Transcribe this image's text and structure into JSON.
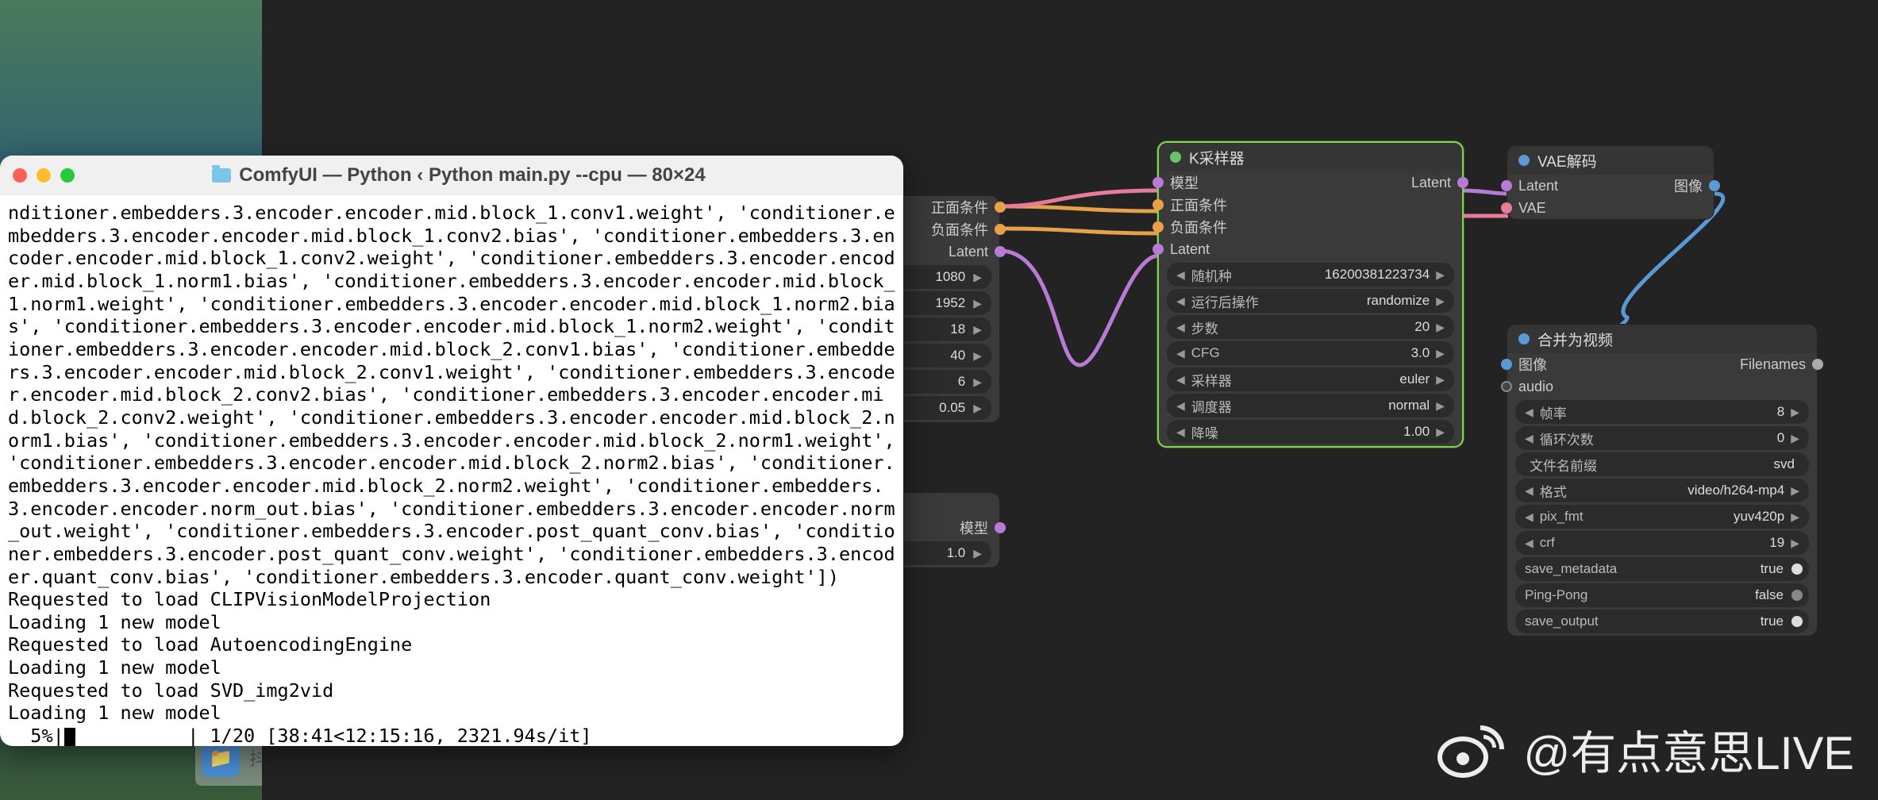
{
  "desktop": {
    "dock_label": "抖"
  },
  "terminal": {
    "title": "ComfyUI — Python ‹ Python main.py --cpu — 80×24",
    "body": "nditioner.embedders.3.encoder.encoder.mid.block_1.conv1.weight', 'conditioner.embedders.3.encoder.encoder.mid.block_1.conv2.bias', 'conditioner.embedders.3.encoder.encoder.mid.block_1.conv2.weight', 'conditioner.embedders.3.encoder.encoder.mid.block_1.norm1.bias', 'conditioner.embedders.3.encoder.encoder.mid.block_1.norm1.weight', 'conditioner.embedders.3.encoder.encoder.mid.block_1.norm2.bias', 'conditioner.embedders.3.encoder.encoder.mid.block_1.norm2.weight', 'conditioner.embedders.3.encoder.encoder.mid.block_2.conv1.bias', 'conditioner.embedders.3.encoder.encoder.mid.block_2.conv1.weight', 'conditioner.embedders.3.encoder.encoder.mid.block_2.conv2.bias', 'conditioner.embedders.3.encoder.encoder.mid.block_2.conv2.weight', 'conditioner.embedders.3.encoder.encoder.mid.block_2.norm1.bias', 'conditioner.embedders.3.encoder.encoder.mid.block_2.norm1.weight', 'conditioner.embedders.3.encoder.encoder.mid.block_2.norm2.bias', 'conditioner.embedders.3.encoder.encoder.mid.block_2.norm2.weight', 'conditioner.embedders.3.encoder.encoder.norm_out.bias', 'conditioner.embedders.3.encoder.encoder.norm_out.weight', 'conditioner.embedders.3.encoder.post_quant_conv.bias', 'conditioner.embedders.3.encoder.post_quant_conv.weight', 'conditioner.embedders.3.encoder.quant_conv.bias', 'conditioner.embedders.3.encoder.quant_conv.weight'])\nRequested to load CLIPVisionModelProjection\nLoading 1 new model\nRequested to load AutoencodingEngine\nLoading 1 new model\nRequested to load SVD_img2vid\nLoading 1 new model",
    "progress": "  5%|",
    "progress_tail": "          | 1/20 [38:41<12:15:16, 2321.94s/it]"
  },
  "partial_top": {
    "rows": [
      "正面条件",
      "负面条件",
      "Latent"
    ],
    "widgets": [
      "1080",
      "1952",
      "18",
      "40",
      "6",
      "0.05"
    ]
  },
  "partial_bottom": {
    "rows": [
      "模型"
    ],
    "widgets": [
      "1.0"
    ]
  },
  "ksampler": {
    "title": "K采样器",
    "inputs": [
      "模型",
      "正面条件",
      "负面条件",
      "Latent"
    ],
    "output": "Latent",
    "widgets": [
      {
        "label": "随机种",
        "value": "16200381223734"
      },
      {
        "label": "运行后操作",
        "value": "randomize"
      },
      {
        "label": "步数",
        "value": "20"
      },
      {
        "label": "CFG",
        "value": "3.0"
      },
      {
        "label": "采样器",
        "value": "euler"
      },
      {
        "label": "调度器",
        "value": "normal"
      },
      {
        "label": "降噪",
        "value": "1.00"
      }
    ]
  },
  "vaedecode": {
    "title": "VAE解码",
    "inputs": [
      "Latent",
      "VAE"
    ],
    "output": "图像"
  },
  "video_combine": {
    "title": "合并为视频",
    "inputs": [
      "图像",
      "audio"
    ],
    "output": "Filenames",
    "widgets": [
      {
        "label": "帧率",
        "value": "8",
        "type": "num"
      },
      {
        "label": "循环次数",
        "value": "0",
        "type": "num"
      },
      {
        "label": "文件名前缀",
        "value": "svd",
        "type": "text"
      },
      {
        "label": "格式",
        "value": "video/h264-mp4",
        "type": "num"
      },
      {
        "label": "pix_fmt",
        "value": "yuv420p",
        "type": "num"
      },
      {
        "label": "crf",
        "value": "19",
        "type": "num"
      },
      {
        "label": "save_metadata",
        "value": "true",
        "type": "toggle",
        "on": true
      },
      {
        "label": "Ping-Pong",
        "value": "false",
        "type": "toggle",
        "on": false
      },
      {
        "label": "save_output",
        "value": "true",
        "type": "toggle",
        "on": true
      }
    ]
  },
  "watermark": "@有点意思LIVE"
}
